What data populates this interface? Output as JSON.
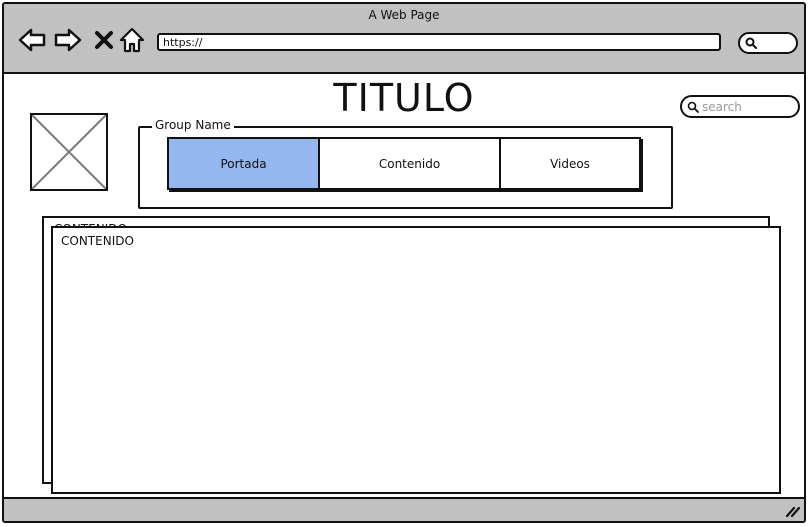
{
  "window": {
    "title": "A Web Page"
  },
  "toolbar": {
    "back_icon": "arrow-left-icon",
    "forward_icon": "arrow-right-icon",
    "close_icon": "x-icon",
    "home_icon": "home-icon",
    "url": "https://",
    "search_icon": "search-icon"
  },
  "page": {
    "title": "TITULO",
    "search_placeholder": "search",
    "image_placeholder_icon": "image-placeholder-icon"
  },
  "group": {
    "label": "Group Name",
    "tabs": [
      {
        "label": "Portada",
        "active": true
      },
      {
        "label": "Contenido",
        "active": false
      },
      {
        "label": "Videos",
        "active": false
      }
    ]
  },
  "content": {
    "back_panel_label": "CONTENIDO",
    "front_panel_label": "CONTENIDO"
  },
  "colors": {
    "chrome_gray": "#c1c1c1",
    "active_tab": "#94b7ef",
    "outline": "#111111",
    "placeholder_text": "#9a9a9a"
  }
}
